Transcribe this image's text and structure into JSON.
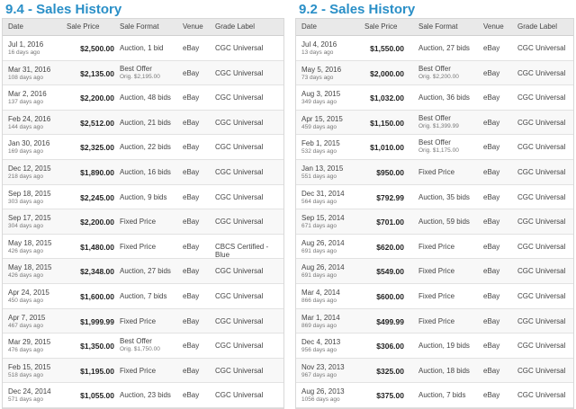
{
  "left": {
    "title": "9.4 - Sales History",
    "headers": {
      "date": "Date",
      "price": "Sale Price",
      "format": "Sale Format",
      "venue": "Venue",
      "grade": "Grade Label"
    },
    "rows": [
      {
        "date": "Jul 1, 2016",
        "ago": "16 days ago",
        "price": "$2,500.00",
        "format": "Auction, 1 bid",
        "format_sub": "",
        "venue": "eBay",
        "grade": "CGC Universal"
      },
      {
        "date": "Mar 31, 2016",
        "ago": "108 days ago",
        "price": "$2,135.00",
        "format": "Best Offer",
        "format_sub": "Orig. $2,195.00",
        "venue": "eBay",
        "grade": "CGC Universal"
      },
      {
        "date": "Mar 2, 2016",
        "ago": "137 days ago",
        "price": "$2,200.00",
        "format": "Auction, 48 bids",
        "format_sub": "",
        "venue": "eBay",
        "grade": "CGC Universal"
      },
      {
        "date": "Feb 24, 2016",
        "ago": "144 days ago",
        "price": "$2,512.00",
        "format": "Auction, 21 bids",
        "format_sub": "",
        "venue": "eBay",
        "grade": "CGC Universal"
      },
      {
        "date": "Jan 30, 2016",
        "ago": "169 days ago",
        "price": "$2,325.00",
        "format": "Auction, 22 bids",
        "format_sub": "",
        "venue": "eBay",
        "grade": "CGC Universal"
      },
      {
        "date": "Dec 12, 2015",
        "ago": "218 days ago",
        "price": "$1,890.00",
        "format": "Auction, 16 bids",
        "format_sub": "",
        "venue": "eBay",
        "grade": "CGC Universal"
      },
      {
        "date": "Sep 18, 2015",
        "ago": "303 days ago",
        "price": "$2,245.00",
        "format": "Auction, 9 bids",
        "format_sub": "",
        "venue": "eBay",
        "grade": "CGC Universal"
      },
      {
        "date": "Sep 17, 2015",
        "ago": "304 days ago",
        "price": "$2,200.00",
        "format": "Fixed Price",
        "format_sub": "",
        "venue": "eBay",
        "grade": "CGC Universal"
      },
      {
        "date": "May 18, 2015",
        "ago": "426 days ago",
        "price": "$1,480.00",
        "format": "Fixed Price",
        "format_sub": "",
        "venue": "eBay",
        "grade": "CBCS Certified - Blue"
      },
      {
        "date": "May 18, 2015",
        "ago": "426 days ago",
        "price": "$2,348.00",
        "format": "Auction, 27 bids",
        "format_sub": "",
        "venue": "eBay",
        "grade": "CGC Universal"
      },
      {
        "date": "Apr 24, 2015",
        "ago": "450 days ago",
        "price": "$1,600.00",
        "format": "Auction, 7 bids",
        "format_sub": "",
        "venue": "eBay",
        "grade": "CGC Universal"
      },
      {
        "date": "Apr 7, 2015",
        "ago": "467 days ago",
        "price": "$1,999.99",
        "format": "Fixed Price",
        "format_sub": "",
        "venue": "eBay",
        "grade": "CGC Universal"
      },
      {
        "date": "Mar 29, 2015",
        "ago": "476 days ago",
        "price": "$1,350.00",
        "format": "Best Offer",
        "format_sub": "Orig. $1,750.00",
        "venue": "eBay",
        "grade": "CGC Universal"
      },
      {
        "date": "Feb 15, 2015",
        "ago": "518 days ago",
        "price": "$1,195.00",
        "format": "Fixed Price",
        "format_sub": "",
        "venue": "eBay",
        "grade": "CGC Universal"
      },
      {
        "date": "Dec 24, 2014",
        "ago": "571 days ago",
        "price": "$1,055.00",
        "format": "Auction, 23 bids",
        "format_sub": "",
        "venue": "eBay",
        "grade": "CGC Universal"
      }
    ]
  },
  "right": {
    "title": "9.2 - Sales History",
    "headers": {
      "date": "Date",
      "price": "Sale Price",
      "format": "Sale Format",
      "venue": "Venue",
      "grade": "Grade Label"
    },
    "rows": [
      {
        "date": "Jul 4, 2016",
        "ago": "13 days ago",
        "price": "$1,550.00",
        "format": "Auction, 27 bids",
        "format_sub": "",
        "venue": "eBay",
        "grade": "CGC Universal"
      },
      {
        "date": "May 5, 2016",
        "ago": "73 days ago",
        "price": "$2,000.00",
        "format": "Best Offer",
        "format_sub": "Orig. $2,200.00",
        "venue": "eBay",
        "grade": "CGC Universal"
      },
      {
        "date": "Aug 3, 2015",
        "ago": "349 days ago",
        "price": "$1,032.00",
        "format": "Auction, 36 bids",
        "format_sub": "",
        "venue": "eBay",
        "grade": "CGC Universal"
      },
      {
        "date": "Apr 15, 2015",
        "ago": "459 days ago",
        "price": "$1,150.00",
        "format": "Best Offer",
        "format_sub": "Orig. $1,399.99",
        "venue": "eBay",
        "grade": "CGC Universal"
      },
      {
        "date": "Feb 1, 2015",
        "ago": "532 days ago",
        "price": "$1,010.00",
        "format": "Best Offer",
        "format_sub": "Orig. $1,175.00",
        "venue": "eBay",
        "grade": "CGC Universal"
      },
      {
        "date": "Jan 13, 2015",
        "ago": "551 days ago",
        "price": "$950.00",
        "format": "Fixed Price",
        "format_sub": "",
        "venue": "eBay",
        "grade": "CGC Universal"
      },
      {
        "date": "Dec 31, 2014",
        "ago": "564 days ago",
        "price": "$792.99",
        "format": "Auction, 35 bids",
        "format_sub": "",
        "venue": "eBay",
        "grade": "CGC Universal"
      },
      {
        "date": "Sep 15, 2014",
        "ago": "671 days ago",
        "price": "$701.00",
        "format": "Auction, 59 bids",
        "format_sub": "",
        "venue": "eBay",
        "grade": "CGC Universal"
      },
      {
        "date": "Aug 26, 2014",
        "ago": "691 days ago",
        "price": "$620.00",
        "format": "Fixed Price",
        "format_sub": "",
        "venue": "eBay",
        "grade": "CGC Universal"
      },
      {
        "date": "Aug 26, 2014",
        "ago": "691 days ago",
        "price": "$549.00",
        "format": "Fixed Price",
        "format_sub": "",
        "venue": "eBay",
        "grade": "CGC Universal"
      },
      {
        "date": "Mar 4, 2014",
        "ago": "866 days ago",
        "price": "$600.00",
        "format": "Fixed Price",
        "format_sub": "",
        "venue": "eBay",
        "grade": "CGC Universal"
      },
      {
        "date": "Mar 1, 2014",
        "ago": "869 days ago",
        "price": "$499.99",
        "format": "Fixed Price",
        "format_sub": "",
        "venue": "eBay",
        "grade": "CGC Universal"
      },
      {
        "date": "Dec 4, 2013",
        "ago": "956 days ago",
        "price": "$306.00",
        "format": "Auction, 19 bids",
        "format_sub": "",
        "venue": "eBay",
        "grade": "CGC Universal"
      },
      {
        "date": "Nov 23, 2013",
        "ago": "967 days ago",
        "price": "$325.00",
        "format": "Auction, 18 bids",
        "format_sub": "",
        "venue": "eBay",
        "grade": "CGC Universal"
      },
      {
        "date": "Aug 26, 2013",
        "ago": "1056 days ago",
        "price": "$375.00",
        "format": "Auction, 7 bids",
        "format_sub": "",
        "venue": "eBay",
        "grade": "CGC Universal"
      }
    ]
  }
}
